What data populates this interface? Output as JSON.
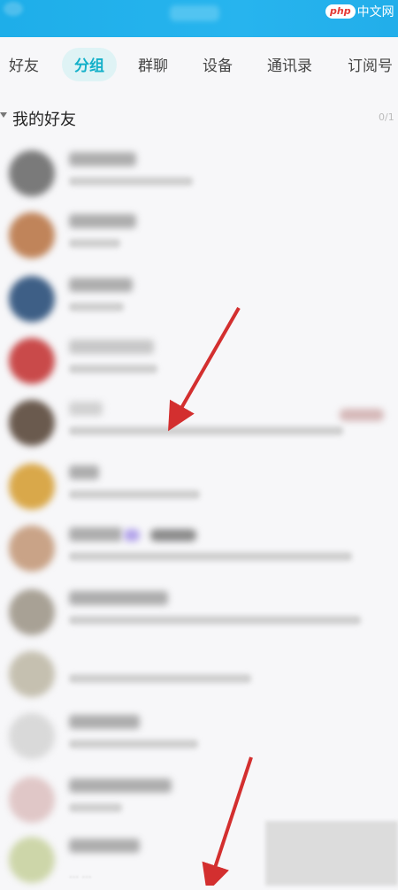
{
  "watermark": {
    "badge": "php",
    "text": "中文网"
  },
  "tabs": [
    {
      "label": "好友"
    },
    {
      "label": "分组"
    },
    {
      "label": "群聊"
    },
    {
      "label": "设备"
    },
    {
      "label": "通讯录"
    },
    {
      "label": "订阅号"
    }
  ],
  "active_tab": "分组",
  "section": {
    "title": "我的好友",
    "count": "0/1"
  },
  "bottom_hint": "… …",
  "colors": {
    "accent": "#13b0c9",
    "topbar": "#1eaee9",
    "arrow": "#d32f2f"
  }
}
